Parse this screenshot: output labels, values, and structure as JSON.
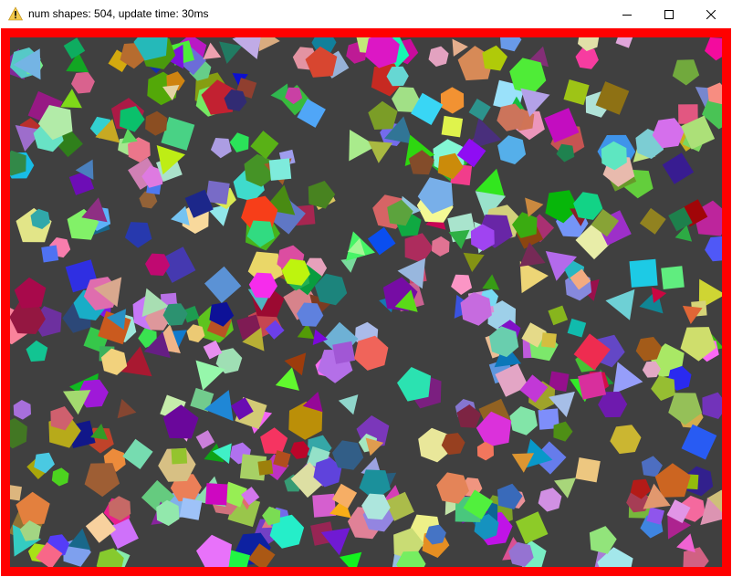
{
  "window": {
    "title": "num shapes: 504, update time: 30ms",
    "title_icon": "warning-icon",
    "buttons": [
      {
        "name": "minimize-button",
        "icon": "minimize-icon"
      },
      {
        "name": "maximize-button",
        "icon": "maximize-icon"
      },
      {
        "name": "close-button",
        "icon": "close-icon"
      }
    ]
  },
  "colors": {
    "border": "#ff0000",
    "canvas_background": "#404040",
    "warning_icon": "#f2c94c"
  },
  "scene": {
    "shape_count": 504,
    "shape_kinds": [
      "triangle",
      "square",
      "pentagon",
      "hexagon"
    ]
  }
}
